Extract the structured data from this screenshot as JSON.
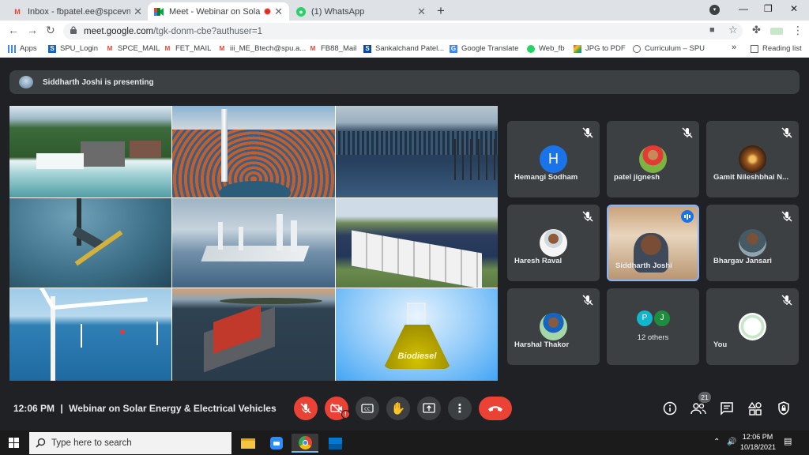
{
  "tabs": [
    {
      "title": "Inbox - fbpatel.ee@spcevng.ac.in",
      "icon": "gmail-icon",
      "active": false
    },
    {
      "title": "Meet - Webinar on Solar Energy",
      "icon": "meet-icon",
      "active": true
    },
    {
      "title": "(1) WhatsApp",
      "icon": "whatsapp-icon",
      "active": false
    }
  ],
  "address": {
    "host": "meet.google.com",
    "path": "/tgk-donm-cbe?authuser=1"
  },
  "bookmarks": [
    {
      "label": "Apps",
      "icon": "apps-grid-icon"
    },
    {
      "label": "SPU_Login",
      "icon": "spu-icon"
    },
    {
      "label": "SPCE_MAIL",
      "icon": "gmail-icon"
    },
    {
      "label": "FET_MAIL",
      "icon": "gmail-icon"
    },
    {
      "label": "iii_ME_Btech@spu.a...",
      "icon": "gmail-icon"
    },
    {
      "label": "FB88_Mail",
      "icon": "gmail-icon"
    },
    {
      "label": "Sankalchand Patel...",
      "icon": "spu-icon"
    },
    {
      "label": "Google Translate",
      "icon": "translate-icon"
    },
    {
      "label": "Web_fb",
      "icon": "whatsapp-icon"
    },
    {
      "label": "JPG to PDF",
      "icon": "jpg-pdf-icon"
    },
    {
      "label": "Curriculum – SPU",
      "icon": "globe-icon"
    }
  ],
  "bookmarks_more": "»",
  "reading_list": "Reading list",
  "presenting": "Siddharth Joshi is presenting",
  "slide_images": [
    {
      "name": "hydro-dam-image"
    },
    {
      "name": "solar-tower-image"
    },
    {
      "name": "floating-solar-image"
    },
    {
      "name": "tidal-turbine-image"
    },
    {
      "name": "wave-energy-image"
    },
    {
      "name": "battery-storage-image"
    },
    {
      "name": "offshore-wind-image"
    },
    {
      "name": "floating-tidal-platform-image"
    },
    {
      "name": "biodiesel-flask-image"
    }
  ],
  "biodiesel_label": "Biodiesel",
  "participants": [
    {
      "name": "Hemangi Sodham",
      "avatar_letter": "H",
      "muted": true
    },
    {
      "name": "patel jignesh",
      "muted": true
    },
    {
      "name": "Gamit Nileshbhai N...",
      "muted": true
    },
    {
      "name": "Haresh Raval",
      "muted": true
    },
    {
      "name": "Siddharth Joshi",
      "muted": false,
      "speaking": true
    },
    {
      "name": "Bhargav Jansari",
      "muted": true
    },
    {
      "name": "Harshal Thakor",
      "muted": true
    },
    {
      "name": "12 others",
      "avatar_letters": [
        "P",
        "J"
      ]
    },
    {
      "name": "You",
      "muted": true
    }
  ],
  "meeting": {
    "time": "12:06 PM",
    "separator": "|",
    "title": "Webinar on Solar Energy & Electrical Vehicles"
  },
  "people_count": "21",
  "taskbar": {
    "search_placeholder": "Type here to search",
    "time": "12:06 PM",
    "date": "10/18/2021"
  },
  "colors": {
    "accent_red": "#ea4335",
    "meet_bg": "#202124",
    "tile_bg": "#3c4043",
    "active_blue": "#8ab4f8"
  }
}
